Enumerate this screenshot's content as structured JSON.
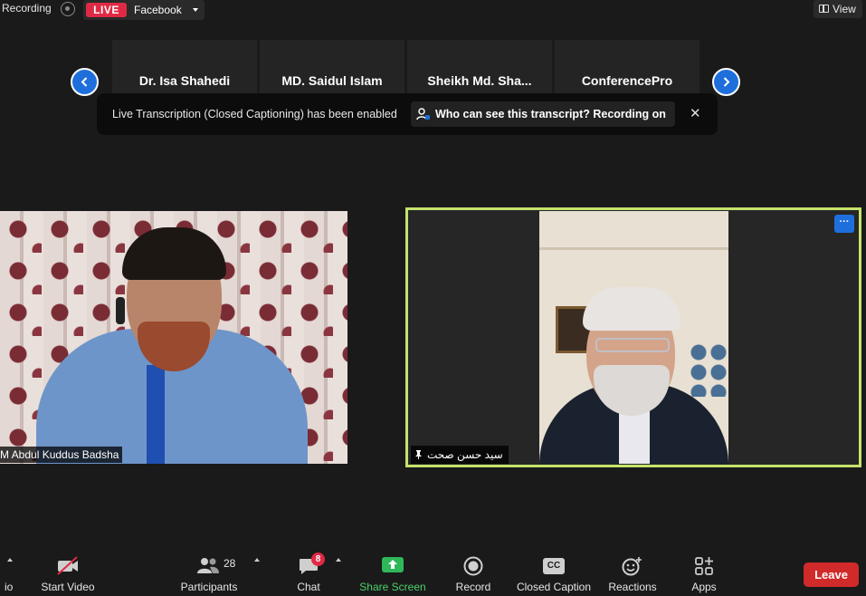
{
  "topbar": {
    "recording_label": "Recording",
    "live_label": "LIVE",
    "stream_target": "Facebook",
    "view_label": "View"
  },
  "thumbnails": [
    {
      "name": "Dr. Isa Shahedi"
    },
    {
      "name": "MD. Saidul Islam"
    },
    {
      "name": "Sheikh  Md.  Sha..."
    },
    {
      "name": "ConferencePro"
    }
  ],
  "banner": {
    "message": "Live Transcription (Closed Captioning) has been enabled",
    "link_text": "Who can see this transcript? Recording on",
    "close_glyph": "✕"
  },
  "videos": {
    "left_name": "M Abdul Kuddus Badsha",
    "right_name": "سید حسن صحت",
    "more_glyph": "···"
  },
  "toolbar": {
    "audio_label": "io",
    "video_label": "Start Video",
    "participants_label": "Participants",
    "participants_count": "28",
    "chat_label": "Chat",
    "chat_badge": "8",
    "share_label": "Share Screen",
    "record_label": "Record",
    "cc_label": "Closed Caption",
    "cc_glyph": "CC",
    "reactions_label": "Reactions",
    "apps_label": "Apps",
    "leave_label": "Leave"
  },
  "colors": {
    "accent_blue": "#1e6fdc",
    "live_red": "#e02a45",
    "active_speaker": "#c5e36b",
    "share_green": "#4ad16a",
    "leave_red": "#d12a2a"
  }
}
